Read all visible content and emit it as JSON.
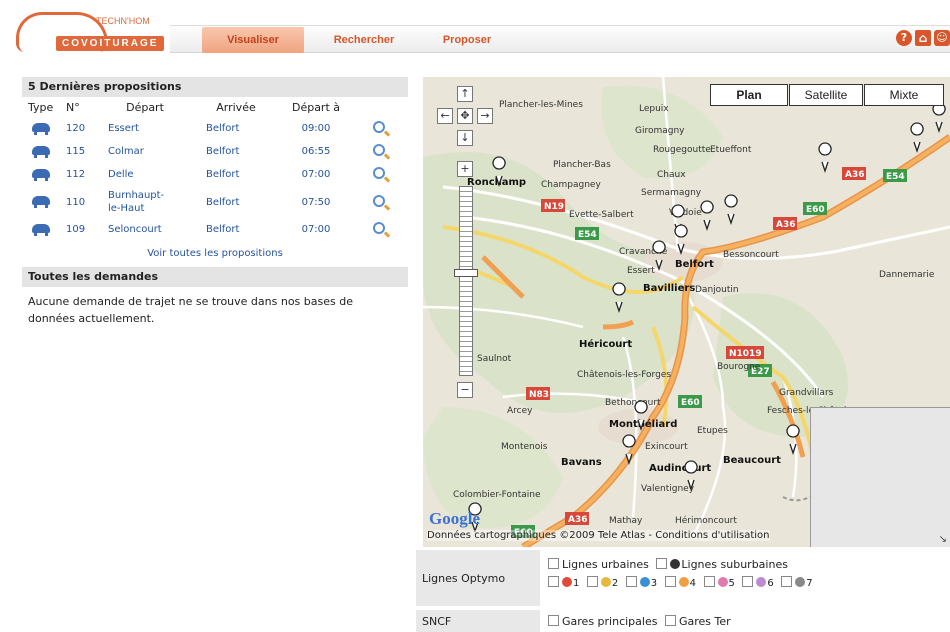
{
  "header": {
    "logo": {
      "top_text": "TECHN'HOM",
      "main_text": "COVOITURAGE"
    },
    "tabs": [
      {
        "label": "Visualiser",
        "active": true
      },
      {
        "label": "Rechercher",
        "active": false
      },
      {
        "label": "Proposer",
        "active": false
      }
    ],
    "icons": [
      "help-icon",
      "home-icon",
      "user-icon"
    ]
  },
  "propositions": {
    "title": "5 Dernières propositions",
    "columns": [
      "Type",
      "N°",
      "Départ",
      "Arrivée",
      "Départ à"
    ],
    "rows": [
      {
        "num": "120",
        "depart": "Essert",
        "arrivee": "Belfort",
        "heure": "09:00"
      },
      {
        "num": "115",
        "depart": "Colmar",
        "arrivee": "Belfort",
        "heure": "06:55"
      },
      {
        "num": "112",
        "depart": "Delle",
        "arrivee": "Belfort",
        "heure": "07:00"
      },
      {
        "num": "110",
        "depart": "Burnhaupt-le-Haut",
        "arrivee": "Belfort",
        "heure": "07:50"
      },
      {
        "num": "109",
        "depart": "Seloncourt",
        "arrivee": "Belfort",
        "heure": "07:00"
      }
    ],
    "see_all": "Voir toutes les propositions"
  },
  "demandes": {
    "title": "Toutes les demandes",
    "text": "Aucune demande de trajet ne se trouve dans nos bases de données actuellement."
  },
  "map": {
    "types": [
      "Plan",
      "Satellite",
      "Mixte"
    ],
    "active_type": "Plan",
    "copyright": "Données cartographiques ©2009 Tele Atlas - Conditions d'utilisation",
    "logo": "Google",
    "places": [
      "Plancher-les-Mines",
      "Lepuix",
      "Giromagny",
      "Rougegoutte",
      "Etueffont",
      "Plancher-Bas",
      "Chaux",
      "Ronchamp",
      "Champagney",
      "Sermamagny",
      "Evette-Salbert",
      "Valdoie",
      "Cravanche",
      "Essert",
      "Belfort",
      "Bessoncourt",
      "Bavilliers",
      "Danjoutin",
      "Héricourt",
      "Bourogne",
      "Châtenois-les-Forges",
      "Grandvillars",
      "Bethoncourt",
      "Montbéliard",
      "Etupes",
      "Fesches-le-Châtel",
      "Arcey",
      "Montenois",
      "Bavans",
      "Exincourt",
      "Audincourt",
      "Beaucourt",
      "Valentigney",
      "Colombier-Fontaine",
      "Mathay",
      "Hérimoncourt",
      "Saulnot",
      "Dannemarie"
    ],
    "roads": [
      "A36",
      "E54",
      "E60",
      "N19",
      "E54",
      "A36",
      "N1019",
      "E27",
      "N83",
      "E60",
      "A36",
      "E60"
    ]
  },
  "legend": {
    "optymo": {
      "label": "Lignes Optymo",
      "urbaines": "Lignes urbaines",
      "suburbaines": "Lignes suburbaines",
      "lines": [
        {
          "n": "1",
          "color": "#e04a3a"
        },
        {
          "n": "2",
          "color": "#e8b83a"
        },
        {
          "n": "3",
          "color": "#3a8fd6"
        },
        {
          "n": "4",
          "color": "#f0a040"
        },
        {
          "n": "5",
          "color": "#e07ab0"
        },
        {
          "n": "6",
          "color": "#c08ad0"
        },
        {
          "n": "7",
          "color": "#888888"
        }
      ]
    },
    "sncf": {
      "label": "SNCF",
      "principales": "Gares principales",
      "ter": "Gares Ter"
    }
  }
}
